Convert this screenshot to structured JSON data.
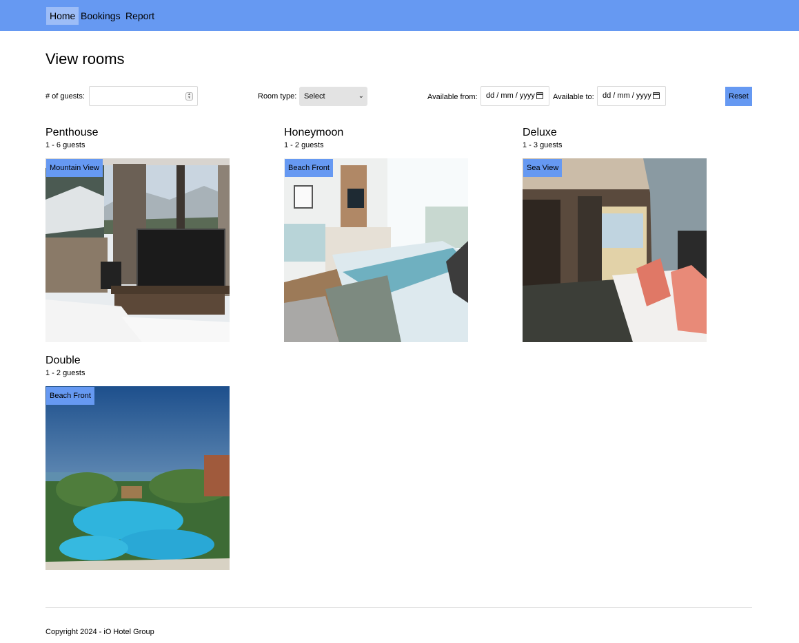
{
  "nav": {
    "home": "Home",
    "bookings": "Bookings",
    "report": "Report"
  },
  "page_title": "View rooms",
  "filters": {
    "guests_label": "# of guests:",
    "guests_value": "",
    "room_type_label": "Room type:",
    "room_type_selected": "Select",
    "available_from_label": "Available from:",
    "available_from_placeholder": "dd / mm / yyyy",
    "available_to_label": "Available to:",
    "available_to_placeholder": "dd / mm / yyyy",
    "reset_label": "Reset"
  },
  "rooms": [
    {
      "name": "Penthouse",
      "guests": "1 - 6 guests",
      "badge": "Mountain View"
    },
    {
      "name": "Honeymoon",
      "guests": "1 - 2 guests",
      "badge": "Beach Front"
    },
    {
      "name": "Deluxe",
      "guests": "1 - 3 guests",
      "badge": "Sea View"
    },
    {
      "name": "Double",
      "guests": "1 - 2 guests",
      "badge": "Beach Front"
    }
  ],
  "footer": {
    "copyright": "Copyright 2024 - iO Hotel Group"
  },
  "colors": {
    "nav_bg": "#6699f2",
    "nav_active": "#9dbdf7",
    "badge_bg": "#6699f2",
    "reset_bg": "#6699f2"
  }
}
